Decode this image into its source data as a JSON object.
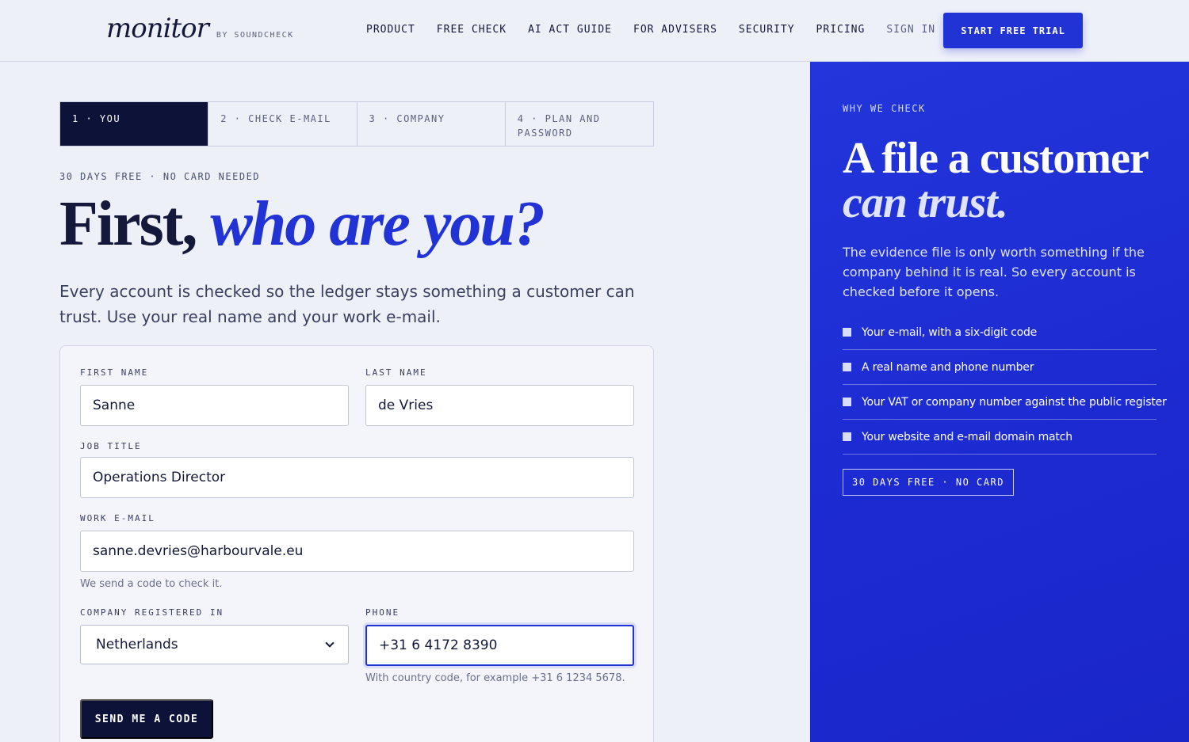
{
  "header": {
    "logo": {
      "word": "monitor",
      "by": "BY SOUNDCHECK"
    },
    "nav": [
      "PRODUCT",
      "FREE CHECK",
      "AI ACT GUIDE",
      "FOR ADVISERS",
      "SECURITY",
      "PRICING"
    ],
    "sign_in": "SIGN IN",
    "cta": "START FREE TRIAL"
  },
  "steps": [
    {
      "label": "1 · YOU",
      "active": true
    },
    {
      "label": "2 · CHECK E-MAIL",
      "active": false
    },
    {
      "label": "3 · COMPANY",
      "active": false
    },
    {
      "label": "4 · PLAN AND PASSWORD",
      "active": false
    }
  ],
  "intro": {
    "eyebrow": "30 DAYS FREE · NO CARD NEEDED",
    "headline_plain": "First, ",
    "headline_accent": "who are you?",
    "lede": "Every account is checked so the ledger stays something a customer can trust. Use your real name and your work e-mail."
  },
  "form": {
    "first_name": {
      "label": "FIRST NAME",
      "value": "Sanne"
    },
    "last_name": {
      "label": "LAST NAME",
      "value": "de Vries"
    },
    "job_title": {
      "label": "JOB TITLE",
      "value": "Operations Director"
    },
    "work_email": {
      "label": "WORK E-MAIL",
      "value": "sanne.devries@harbourvale.eu",
      "help": "We send a code to check it."
    },
    "country": {
      "label": "COMPANY REGISTERED IN",
      "value": "Netherlands"
    },
    "phone": {
      "label": "PHONE",
      "value": "+31 6 4172 8390",
      "help": "With country code, for example +31 6 1234 5678."
    },
    "submit": "SEND ME A CODE"
  },
  "panel": {
    "eyebrow": "WHY WE CHECK",
    "title_line1": "A file a customer",
    "title_line2": "can trust.",
    "copy": "The evidence file is only worth something if the company behind it is real. So every account is checked before it opens.",
    "checks": [
      "Your e-mail, with a six-digit code",
      "A real name and phone number",
      "Your VAT or company number against the public register",
      "Your website and e-mail domain match"
    ],
    "badge": "30 DAYS FREE · NO CARD"
  },
  "colors": {
    "accent": "#2233d6",
    "ink": "#0d1238",
    "background": "#eef0f8"
  }
}
